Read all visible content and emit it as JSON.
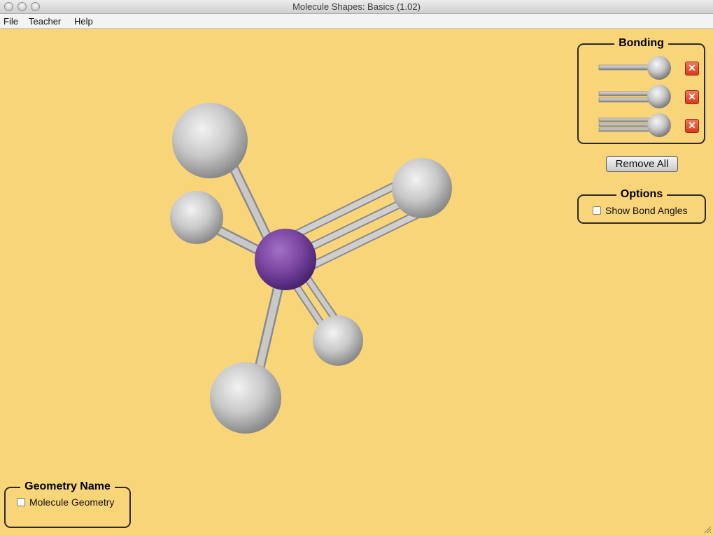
{
  "window": {
    "title": "Molecule Shapes: Basics (1.02)"
  },
  "menu": {
    "items": [
      "File",
      "Teacher",
      "Help"
    ]
  },
  "bonding": {
    "title": "Bonding",
    "rows": [
      {
        "bond": "single",
        "remove_icon": "close-icon"
      },
      {
        "bond": "double",
        "remove_icon": "close-icon"
      },
      {
        "bond": "triple",
        "remove_icon": "close-icon"
      }
    ],
    "remove_all_label": "Remove All"
  },
  "options": {
    "title": "Options",
    "show_bond_angles_label": "Show Bond Angles",
    "show_bond_angles_checked": false
  },
  "geometry": {
    "title": "Geometry Name",
    "molecule_geometry_label": "Molecule Geometry",
    "molecule_geometry_checked": false
  },
  "molecule": {
    "central_atom_color": "#7a45a0",
    "ligand_color": "#d4d4d4",
    "bond_orders": [
      1,
      1,
      1,
      2,
      3
    ]
  },
  "colors": {
    "background": "#f9d57a",
    "delete_button": "#e04a2a"
  }
}
